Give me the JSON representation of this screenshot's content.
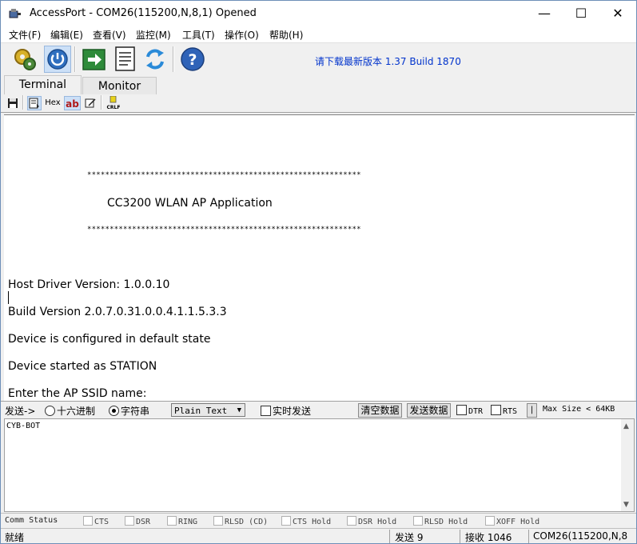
{
  "window": {
    "title": "AccessPort - COM26(115200,N,8,1) Opened",
    "minimize": "—",
    "maximize": "☐",
    "close": "✕"
  },
  "menu": [
    "文件(F)",
    "编辑(E)",
    "查看(V)",
    "监控(M)",
    "工具(T)",
    "操作(O)",
    "帮助(H)"
  ],
  "toolbar": {
    "update_text": "请下载最新版本 1.37 Build 1870"
  },
  "tabs": [
    "Terminal",
    "Monitor"
  ],
  "subtoolbar": {
    "hex_label": "Hex",
    "ab_label": "ab",
    "crlf_label": "CRLF"
  },
  "terminal": {
    "stars_top": "*************************************************************",
    "app_title": "CC3200 WLAN AP Application",
    "stars_bottom": "*************************************************************",
    "lines": [
      "Host Driver Version: 1.0.0.10",
      "Build Version 2.0.7.0.31.0.0.4.1.1.5.3.3",
      "Device is configured in default state",
      "Device started as STATION",
      "Enter the AP SSID name:"
    ]
  },
  "sendbar": {
    "send_label": "发送->",
    "hex_radio": "十六进制",
    "string_radio": "字符串",
    "format_select": "Plain Text",
    "realtime_send": "实时发送",
    "clear_button": "清空数据",
    "send_button": "发送数据",
    "dtr": "DTR",
    "rts": "RTS",
    "sep": "|",
    "max_size": "Max Size < 64KB"
  },
  "send_text": "CYB-BOT",
  "comm_status": {
    "label": "Comm Status",
    "items": [
      "CTS",
      "DSR",
      "RING",
      "RLSD (CD)",
      "CTS Hold",
      "DSR Hold",
      "RLSD Hold",
      "XOFF Hold"
    ]
  },
  "statusbar": {
    "ready": "就绪",
    "sent": "发送 9",
    "received": "接收 1046",
    "port": "COM26(115200,N,8"
  }
}
